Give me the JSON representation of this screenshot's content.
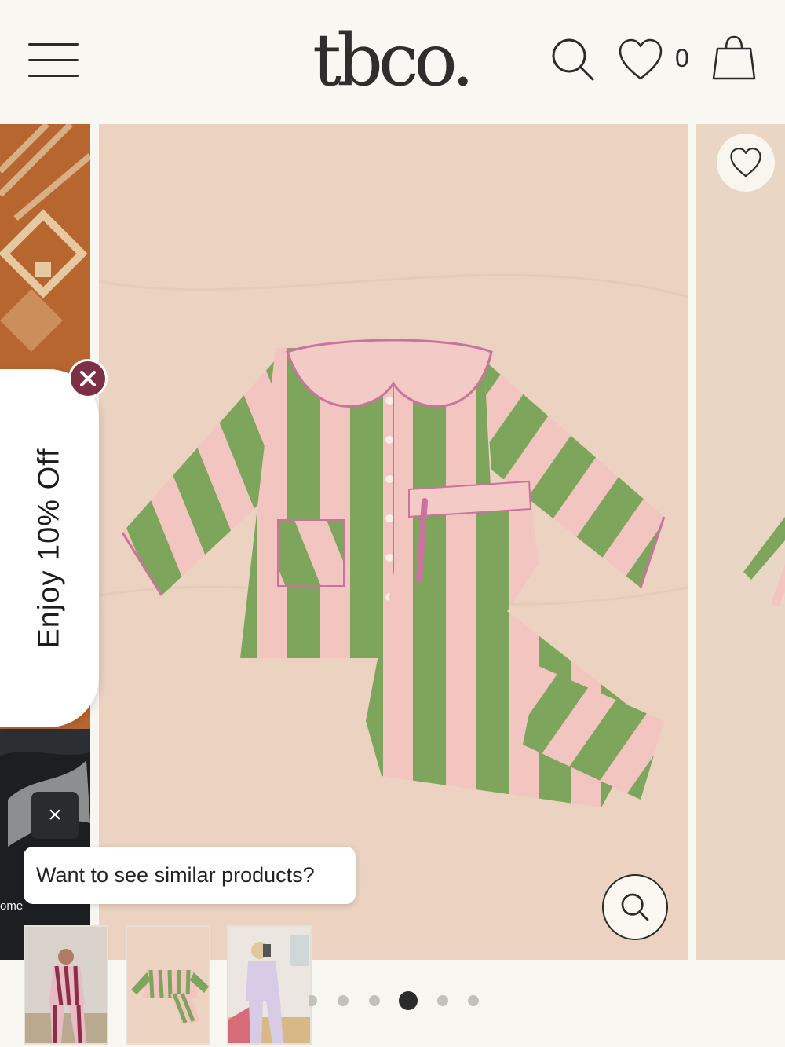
{
  "header": {
    "logo": "tbco.",
    "wishlist_count": "0",
    "icons": [
      "menu-icon",
      "search-icon",
      "heart-icon",
      "shopping-bag-icon"
    ]
  },
  "gallery": {
    "active_slide": 4,
    "slide_count": 6,
    "main_image_alt": "Green and pink striped pyjama set with ruffle collar",
    "colors": {
      "stripe_green": "#7ea35c",
      "stripe_pink": "#f2c4c0",
      "background": "#ecd3c2"
    }
  },
  "discount": {
    "label": "Enjoy 10% Off",
    "close_icon": "close-icon",
    "accent": "#7d2f45"
  },
  "similar": {
    "prompt": "Want to see similar products?",
    "close_label": "×",
    "snippet": "ome"
  },
  "thumbnails": [
    {
      "alt": "Woman wearing pink and burgundy striped pyjamas"
    },
    {
      "alt": "Green and pink striped pyjama set flat lay"
    },
    {
      "alt": "Woman in lilac pyjamas taking mirror selfie"
    }
  ]
}
